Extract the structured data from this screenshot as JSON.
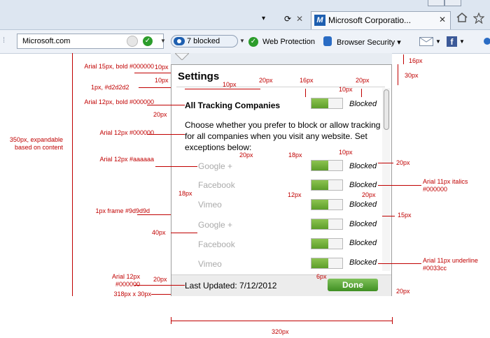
{
  "browser": {
    "tab_title": "Microsoft Corporatio...",
    "tab_logo": "M",
    "tab_close": "✕",
    "address": "Microsoft.com",
    "blocked_label": "7 blocked",
    "web_protection": "Web Protection",
    "browser_security": "Browser Security ▾",
    "nav_icons": [
      "▾",
      "⟳",
      "✕"
    ]
  },
  "panel": {
    "title": "Settings",
    "section_title": "All Tracking Companies",
    "section_state": "Blocked",
    "description": "Choose whether you prefer to block or allow tracking for all companies when you visit any website. Set exceptions below:",
    "sites": [
      {
        "name": "Google +",
        "state": "Blocked"
      },
      {
        "name": "Facebook",
        "state": "Blocked"
      },
      {
        "name": "Vimeo",
        "state": "Blocked"
      },
      {
        "name": "Google +",
        "state": "Blocked"
      },
      {
        "name": "Facebook",
        "state": "Blocked"
      },
      {
        "name": "Vimeo",
        "state": "Blocked"
      }
    ],
    "footer_text": "Last Updated: 7/12/2012",
    "done_label": "Done"
  },
  "annotations": {
    "a1": "Arial 15px, bold #000000",
    "a2": "1px, #d2d2d2",
    "a3": "Arial 12px, bold #000000",
    "a4": "Arial 12px #000000",
    "a5": "350px, expandable based on content",
    "a6": "Arial 12px #aaaaaa",
    "a7": "1px frame #9d9d9d",
    "a8": "Arial 12px #000000",
    "a9": "318px x 30px",
    "a10": "Arial 11px italics #000000",
    "a11": "Arial 11px underline #0033cc",
    "d10a": "10px",
    "d10b": "10px",
    "d10c": "10px",
    "d10d": "10px",
    "d20a": "20px",
    "d20b": "20px",
    "d20c": "20px",
    "d20d": "20px",
    "d20e": "20px",
    "d20f": "20px",
    "d20g": "20px",
    "d20h": "20px",
    "d16a": "16px",
    "d16b": "16px",
    "d30": "30px",
    "d18a": "18px",
    "d18b": "18px",
    "d12": "12px",
    "d15": "15px",
    "d40": "40px",
    "d6": "6px",
    "d320": "320px"
  }
}
